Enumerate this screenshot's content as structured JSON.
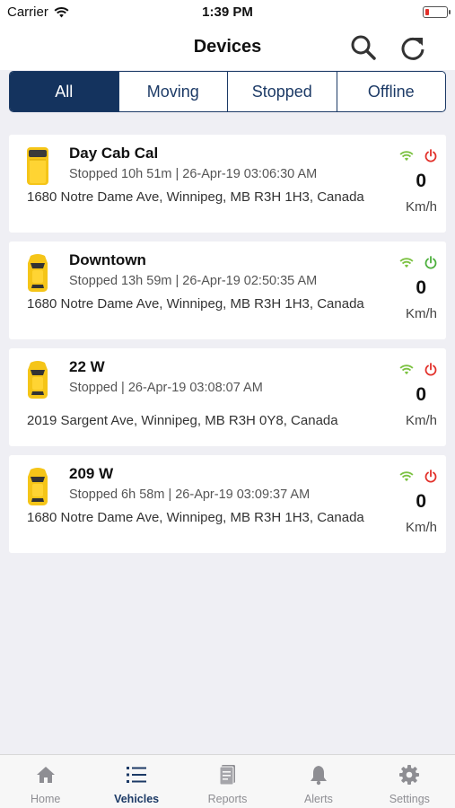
{
  "status_bar": {
    "carrier": "Carrier",
    "time": "1:39 PM"
  },
  "header": {
    "title": "Devices"
  },
  "filters": [
    {
      "label": "All",
      "active": true
    },
    {
      "label": "Moving",
      "active": false
    },
    {
      "label": "Stopped",
      "active": false
    },
    {
      "label": "Offline",
      "active": false
    }
  ],
  "devices": [
    {
      "name": "Day Cab Cal",
      "status": "Stopped 10h 51m  | 26-Apr-19 03:06:30 AM",
      "address": "1680 Notre Dame Ave, Winnipeg, MB R3H 1H3, Canada",
      "speed": "0",
      "unit": "Km/h",
      "power_color": "#e2302a",
      "icon": "van"
    },
    {
      "name": "Downtown",
      "status": "Stopped 13h 59m  | 26-Apr-19 02:50:35 AM",
      "address": "1680 Notre Dame Ave, Winnipeg, MB R3H 1H3, Canada",
      "speed": "0",
      "unit": "Km/h",
      "power_color": "#4caf3c",
      "icon": "car"
    },
    {
      "name": "22 W",
      "status": "Stopped  | 26-Apr-19 03:08:07 AM",
      "address": "2019 Sargent Ave, Winnipeg, MB R3H 0Y8, Canada",
      "speed": "0",
      "unit": "Km/h",
      "power_color": "#e2302a",
      "icon": "car"
    },
    {
      "name": "209 W",
      "status": "Stopped 6h 58m  | 26-Apr-19 03:09:37 AM",
      "address": "1680 Notre Dame Ave, Winnipeg, MB R3H 1H3, Canada",
      "speed": "0",
      "unit": "Km/h",
      "power_color": "#e2302a",
      "icon": "car"
    }
  ],
  "tabbar": [
    {
      "label": "Home",
      "icon": "home-icon",
      "active": false
    },
    {
      "label": "Vehicles",
      "icon": "list-icon",
      "active": true
    },
    {
      "label": "Reports",
      "icon": "report-icon",
      "active": false
    },
    {
      "label": "Alerts",
      "icon": "bell-icon",
      "active": false
    },
    {
      "label": "Settings",
      "icon": "gear-icon",
      "active": false
    }
  ],
  "colors": {
    "accent": "#14335e",
    "vehicle": "#f5c518",
    "signal": "#7cc242",
    "inactive_tab": "#8e8e93"
  }
}
